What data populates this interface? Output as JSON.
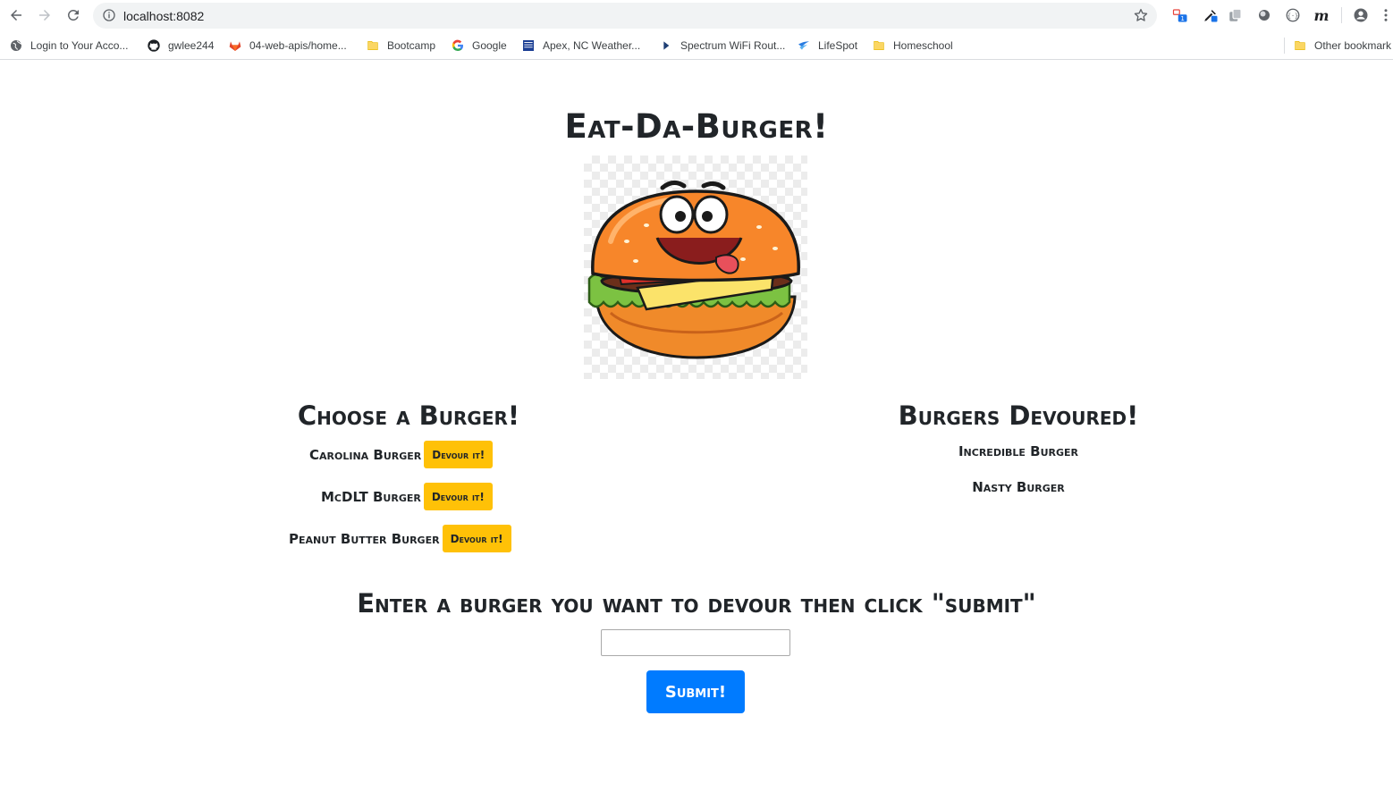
{
  "browser": {
    "url": "localhost:8082",
    "bookmarks": [
      {
        "label": "Login to Your Acco...",
        "icon": "globe-icon"
      },
      {
        "label": "gwlee244",
        "icon": "github-icon"
      },
      {
        "label": "04-web-apis/home...",
        "icon": "gitlab-icon"
      },
      {
        "label": "Bootcamp",
        "icon": "folder-icon"
      },
      {
        "label": "Google",
        "icon": "google-icon"
      },
      {
        "label": "Apex, NC Weather...",
        "icon": "weather-channel-icon"
      },
      {
        "label": "Spectrum WiFi Rout...",
        "icon": "play-icon"
      },
      {
        "label": "LifeSpot",
        "icon": "lifespot-icon"
      },
      {
        "label": "Homeschool",
        "icon": "folder-icon"
      }
    ],
    "other_bookmarks": "Other bookmark",
    "extension_badge": "1",
    "extension_letter": "m",
    "colors": {
      "chrome_bg": "#ffffff",
      "omnibox_bg": "#f1f3f4",
      "folder": "#fbd663"
    }
  },
  "page": {
    "title": "Eat-Da-Burger!",
    "hero_image": "cartoon-burger-image",
    "left_column": {
      "heading": "Choose a Burger!",
      "burgers": [
        {
          "name": "Carolina Burger",
          "button": "Devour it!"
        },
        {
          "name": "McDLT Burger",
          "button": "Devour it!"
        },
        {
          "name": "Peanut Butter Burger",
          "button": "Devour it!"
        }
      ]
    },
    "right_column": {
      "heading": "Burgers Devoured!",
      "burgers": [
        {
          "name": "Incredible Burger"
        },
        {
          "name": "Nasty Burger"
        }
      ]
    },
    "form": {
      "prompt": "Enter a burger you want to devour then click \"submit\"",
      "input_value": "",
      "submit_label": "Submit!"
    },
    "colors": {
      "devour_button": "#ffc107",
      "submit_button": "#007bff",
      "text": "#212529"
    }
  }
}
